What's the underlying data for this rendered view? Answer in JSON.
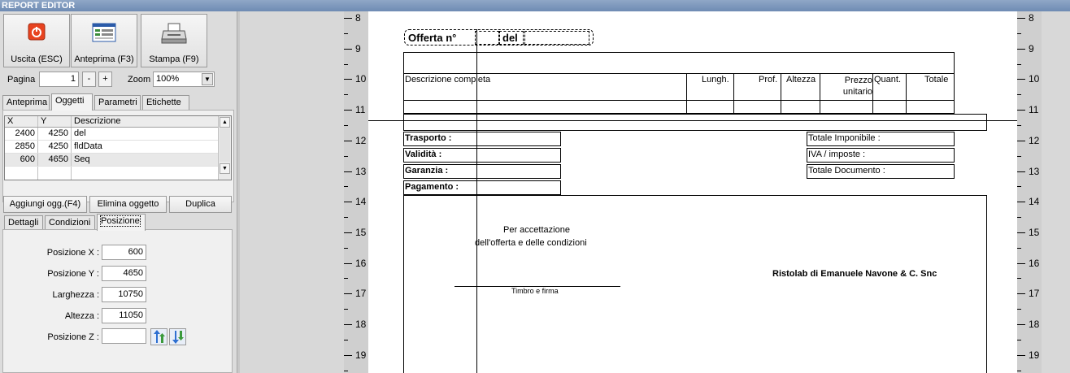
{
  "window": {
    "title": "REPORT EDITOR"
  },
  "toolbar": {
    "exit_label": "Uscita (ESC)",
    "preview_label": "Anteprima (F3)",
    "print_label": "Stampa (F9)"
  },
  "pager": {
    "page_label": "Pagina",
    "page_value": "1",
    "minus": "-",
    "plus": "+",
    "zoom_label": "Zoom",
    "zoom_value": "100%"
  },
  "tabs_top": [
    "Anteprima",
    "Oggetti",
    "Parametri",
    "Etichette"
  ],
  "grid": {
    "columns": [
      "X",
      "Y",
      "Descrizione"
    ],
    "rows": [
      {
        "x": "2400",
        "y": "4250",
        "desc": "del"
      },
      {
        "x": "2850",
        "y": "4250",
        "desc": "fldData"
      },
      {
        "x": "600",
        "y": "4650",
        "desc": "Seq"
      }
    ]
  },
  "actions": {
    "add": "Aggiungi ogg.(F4)",
    "delete": "Elimina oggetto",
    "duplicate": "Duplica"
  },
  "tabs_bottom": [
    "Dettagli",
    "Condizioni",
    "Posizione"
  ],
  "position": {
    "x_label": "Posizione X :",
    "x_value": "600",
    "y_label": "Posizione Y :",
    "y_value": "4650",
    "w_label": "Larghezza :",
    "w_value": "10750",
    "h_label": "Altezza :",
    "h_value": "11050",
    "z_label": "Posizione Z :",
    "z_value": ""
  },
  "ruler": {
    "numbers": [
      "8",
      "9",
      "10",
      "11",
      "12",
      "13",
      "14",
      "15",
      "16",
      "17",
      "18",
      "19"
    ]
  },
  "document": {
    "offer_label": "Offerta n°",
    "del_label": "del",
    "headers": {
      "desc": "Descrizione completa",
      "lungh": "Lungh.",
      "prof": "Prof.",
      "altezza": "Altezza",
      "prezzo": "Prezzo unitario",
      "quant": "Quant.",
      "totale": "Totale"
    },
    "trasporto": "Trasporto :",
    "validita": "Validità :",
    "garanzia": "Garanzia :",
    "pagamento": "Pagamento :",
    "tot_imponibile": "Totale Imponibile :",
    "iva": "IVA / imposte :",
    "tot_documento": "Totale Documento :",
    "accept_line1": "Per accettazione",
    "accept_line2": "dell'offerta e delle condizioni",
    "company": "Ristolab di Emanuele Navone & C. Snc",
    "stamp": "Timbro e firma"
  }
}
